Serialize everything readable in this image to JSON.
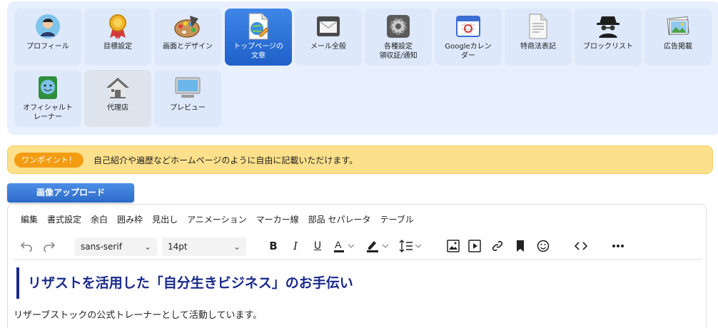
{
  "nav": {
    "tiles": [
      {
        "label": "プロフィール",
        "icon": "profile-avatar-icon"
      },
      {
        "label": "目標設定",
        "icon": "medal-icon"
      },
      {
        "label": "画面とデザイン",
        "icon": "palette-icon"
      },
      {
        "label": "トップページの\n文章",
        "icon": "document-globe-icon",
        "active": true
      },
      {
        "label": "メール全般",
        "icon": "envelope-icon"
      },
      {
        "label": "各種設定\n領収証/通知",
        "icon": "settings-gear-icon"
      },
      {
        "label": "Googleカレン\nダー",
        "icon": "calendar-icon"
      },
      {
        "label": "特商法表記",
        "icon": "document-icon"
      },
      {
        "label": "ブロックリスト",
        "icon": "spy-icon"
      },
      {
        "label": "広告掲載",
        "icon": "photo-icon"
      },
      {
        "label": "オフィシャルト\nレーナー",
        "icon": "trainer-badge-icon"
      },
      {
        "label": "代理店",
        "icon": "house-icon"
      },
      {
        "label": "プレビュー",
        "icon": "monitor-icon"
      }
    ]
  },
  "hint": {
    "badge": "ワンポイント！",
    "text": "自己紹介や遍歴などホームページのように自由に記載いただけます。"
  },
  "upload": {
    "label": "画像アップロード"
  },
  "editor": {
    "menu": [
      "編集",
      "書式設定",
      "余白",
      "囲み枠",
      "見出し",
      "アニメーション",
      "マーカー線",
      "部品 セパレータ",
      "テーブル"
    ],
    "font_family": "sans-serif",
    "font_size": "14pt",
    "heading": "リザストを活用した「自分生きビジネス」のお手伝い",
    "paragraph": "リザーブストックの公式トレーナーとして活動しています。"
  },
  "colors": {
    "panel": "#e8f0fd",
    "tile": "#dde8fb",
    "active": "#2f73d8",
    "hint_bg": "#fde08b",
    "hint_badge": "#f39c12",
    "heading": "#1a2a8c"
  }
}
